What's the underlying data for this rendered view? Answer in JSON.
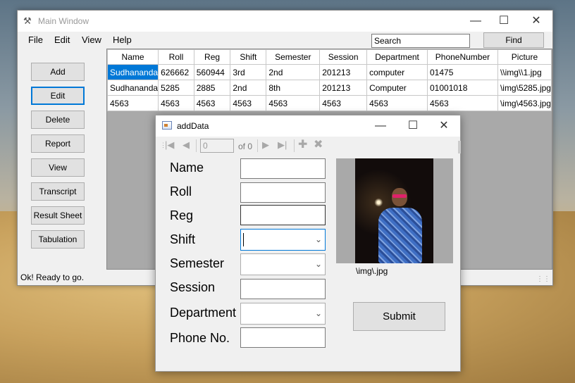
{
  "main_window": {
    "title": "Main Window",
    "menu": [
      "File",
      "Edit",
      "View",
      "Help"
    ],
    "search_value": "Search",
    "find_label": "Find",
    "sidebar_buttons": [
      "Add",
      "Edit",
      "Delete",
      "Report",
      "View",
      "Transcript",
      "Result Sheet",
      "Tabulation"
    ],
    "table": {
      "columns": [
        "Name",
        "Roll",
        "Reg",
        "Shift",
        "Semester",
        "Session",
        "Department",
        "PhoneNumber",
        "Picture"
      ],
      "rows": [
        [
          "Sudhananda",
          "626662",
          "560944",
          "3rd",
          "2nd",
          "201213",
          "computer",
          "01475",
          "\\\\img\\\\1.jpg"
        ],
        [
          "Sudhananda",
          "5285",
          "2885",
          "2nd",
          "8th",
          "201213",
          "Computer",
          "01001018",
          "\\img\\5285.jpg"
        ],
        [
          "4563",
          "4563",
          "4563",
          "4563",
          "4563",
          "4563",
          "4563",
          "4563",
          "\\img\\4563.jpg"
        ]
      ]
    },
    "status": "Ok! Ready to go."
  },
  "dialog": {
    "title": "addData",
    "nav_position": "0",
    "nav_of": "of 0",
    "labels": [
      "Name",
      "Roll",
      "Reg",
      "Shift",
      "Semester",
      "Session",
      "Department",
      "Phone No."
    ],
    "picture_caption": "\\img\\.jpg",
    "submit_label": "Submit"
  },
  "colors": {
    "selection": "#0078d7",
    "window_bg": "#f0f0f0",
    "grid_bg": "#a9a9a9"
  }
}
